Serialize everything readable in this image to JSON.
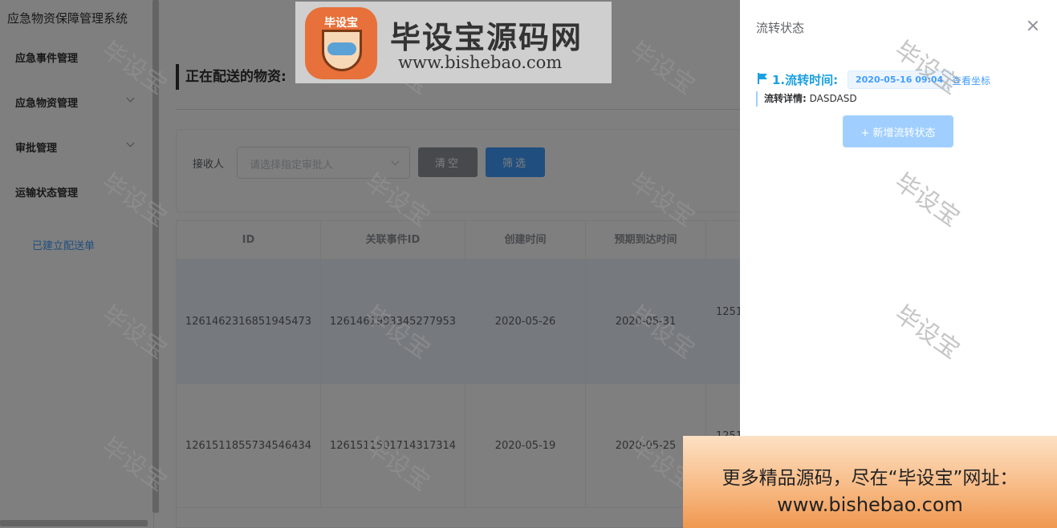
{
  "app": {
    "title": "应急物资保障管理系统"
  },
  "sidebar": {
    "items": [
      {
        "label": "应急事件管理"
      },
      {
        "label": "应急物资管理"
      },
      {
        "label": "审批管理"
      },
      {
        "label": "运输状态管理"
      }
    ],
    "active_sub": "已建立配送单"
  },
  "main": {
    "section_title": "正在配送的物资:",
    "filter": {
      "receiver_label": "接收人",
      "receiver_placeholder": "请选择指定审批人",
      "clear_label": "清空",
      "filter_label": "筛选"
    },
    "table": {
      "columns": [
        "ID",
        "关联事件ID",
        "创建时间",
        "预期到达时间"
      ],
      "rows": [
        {
          "id": "1261462316851945473",
          "event_id": "1261461993345277953",
          "created": "2020-05-26",
          "eta": "2020-05-31",
          "extra": "1251"
        },
        {
          "id": "1261511855734546434",
          "event_id": "1261511501714317314",
          "created": "2020-05-19",
          "eta": "2020-05-25",
          "extra": "1251"
        }
      ]
    }
  },
  "drawer": {
    "title": "流转状态",
    "flow": {
      "heading": "1.流转时间:",
      "time": "2020-05-16 09:04",
      "link": "查看坐标",
      "detail_label": "流转详情:",
      "detail_value": "DASDASD"
    },
    "add_button": "+ 新增流转状态"
  },
  "watermark": {
    "text": "毕设宝",
    "logo_badge": "毕设宝",
    "logo_cn": "毕设宝源码网",
    "logo_url": "www.bishebao.com",
    "promo_line1": "更多精品源码，尽在“毕设宝”网址：",
    "promo_line2": "www.bishebao.com"
  },
  "colors": {
    "primary": "#409eff",
    "flow_heading": "#1a9fe0",
    "overlay": "rgba(0,0,0,0.5)",
    "clear_button": "#909399"
  },
  "icons": [
    "chevron-down-icon",
    "close-icon",
    "flag-icon"
  ]
}
